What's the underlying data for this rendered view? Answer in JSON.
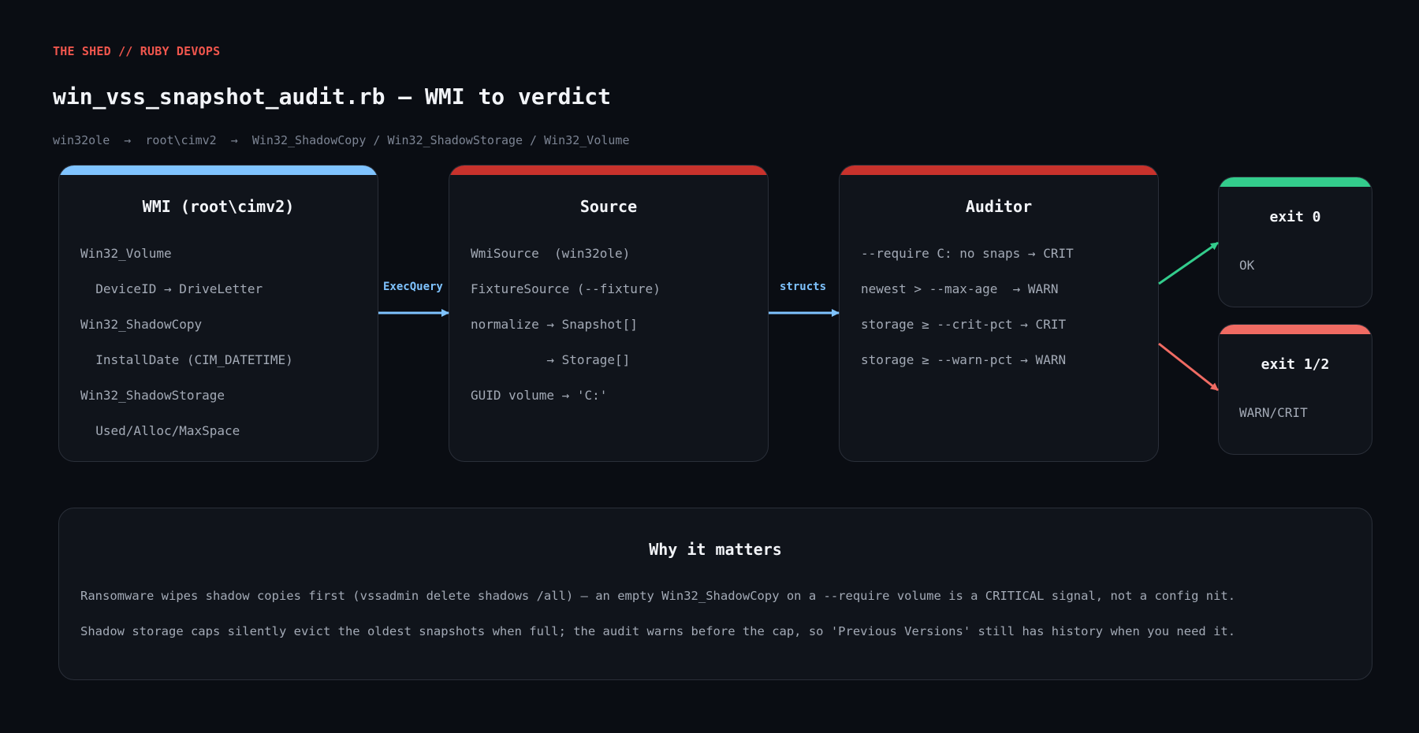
{
  "header": {
    "kicker": "THE SHED // RUBY DEVOPS",
    "title": "win_vss_snapshot_audit.rb — WMI to verdict",
    "subtitle": "win32ole  →  root\\cimv2  →  Win32_ShadowCopy / Win32_ShadowStorage / Win32_Volume"
  },
  "nodes": {
    "wmi": {
      "title": "WMI (root\\cimv2)",
      "band_color": "#7fc3ff",
      "lines": [
        "Win32_Volume",
        "  DeviceID → DriveLetter",
        "Win32_ShadowCopy",
        "  InstallDate (CIM_DATETIME)",
        "Win32_ShadowStorage",
        "  Used/Alloc/MaxSpace"
      ]
    },
    "source": {
      "title": "Source",
      "band_color": "#c8322c",
      "lines": [
        "WmiSource  (win32ole)",
        "FixtureSource (--fixture)",
        "normalize → Snapshot[]",
        "          → Storage[]",
        "GUID volume → 'C:'"
      ]
    },
    "auditor": {
      "title": "Auditor",
      "band_color": "#c8322c",
      "lines": [
        "--require C: no snaps → CRIT",
        "newest > --max-age  → WARN",
        "storage ≥ --crit-pct → CRIT",
        "storage ≥ --warn-pct → WARN"
      ]
    },
    "exit_ok": {
      "title": "exit 0",
      "band_color": "#33cc8c",
      "lines": [
        "OK"
      ]
    },
    "exit_fail": {
      "title": "exit 1/2",
      "band_color": "#f06b63",
      "lines": [
        "WARN/CRIT"
      ]
    }
  },
  "edges": {
    "wmi_to_source": {
      "label": "ExecQuery",
      "color": "#7fc3ff"
    },
    "source_to_auditor": {
      "label": "structs",
      "color": "#7fc3ff"
    },
    "auditor_to_ok": {
      "color": "#33cc8c"
    },
    "auditor_to_fail": {
      "color": "#f06b63"
    }
  },
  "why": {
    "title": "Why it matters",
    "lines": [
      "Ransomware wipes shadow copies first (vssadmin delete shadows /all) — an empty Win32_ShadowCopy on a --require volume is a CRITICAL signal, not a config nit.",
      "Shadow storage caps silently evict the oldest snapshots when full; the audit warns before the cap, so 'Previous Versions' still has history when you need it."
    ]
  }
}
